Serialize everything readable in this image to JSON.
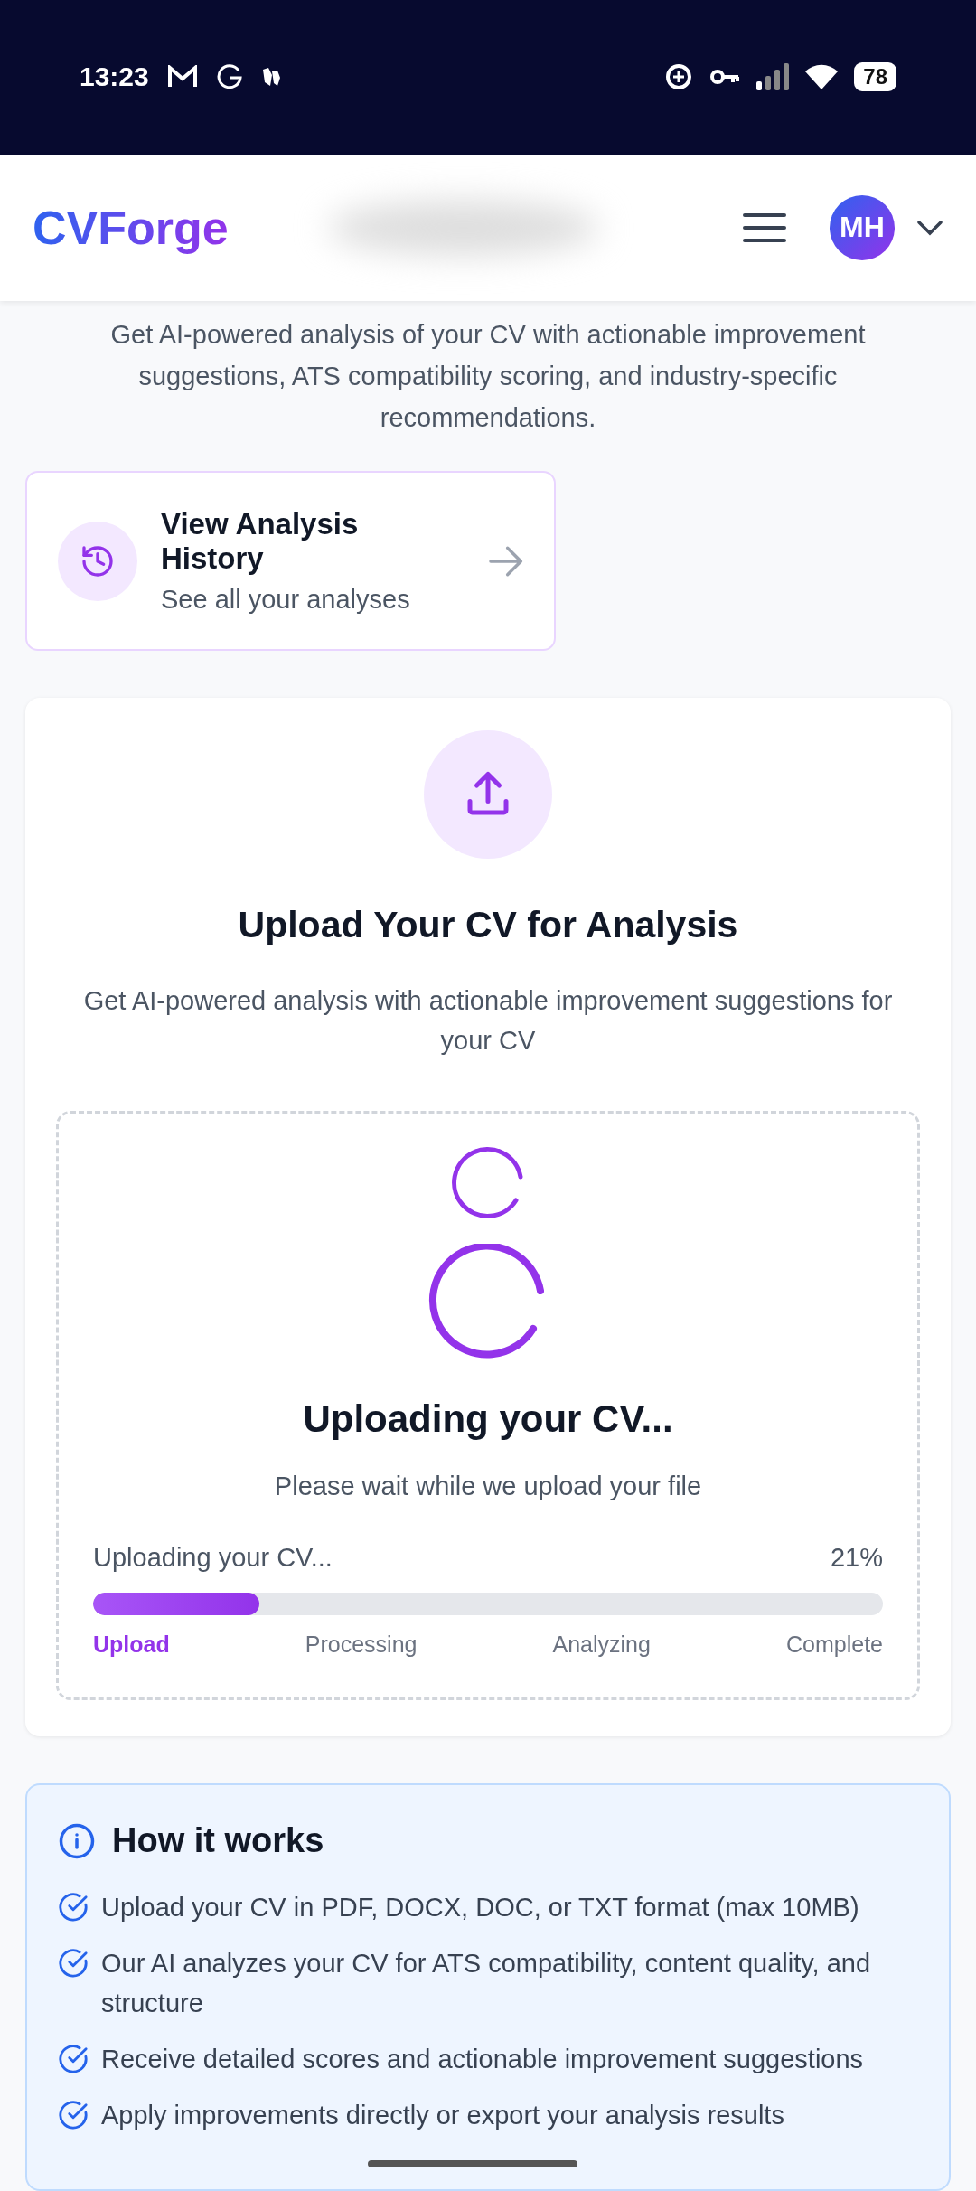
{
  "status_bar": {
    "time": "13:23",
    "battery": "78"
  },
  "header": {
    "logo": "CVForge",
    "avatar_initials": "MH"
  },
  "intro": "Get AI-powered analysis of your CV with actionable improvement suggestions, ATS compatibility scoring, and industry-specific recommendations.",
  "history_card": {
    "title": "View Analysis History",
    "subtitle": "See all your analyses"
  },
  "upload_card": {
    "title": "Upload Your CV for Analysis",
    "description": "Get AI-powered analysis with actionable improvement suggestions for your CV",
    "status_title": "Uploading your CV...",
    "status_text": "Please wait while we upload your file",
    "progress": {
      "label": "Uploading your CV...",
      "percent": "21%",
      "level": 0.21
    },
    "steps": [
      {
        "label": "Upload",
        "selected": true
      },
      {
        "label": "Processing",
        "selected": false
      },
      {
        "label": "Analyzing",
        "selected": false
      },
      {
        "label": "Complete",
        "selected": false
      }
    ]
  },
  "how_it_works": {
    "title": "How it works",
    "items": [
      "Upload your CV in PDF, DOCX, DOC, or TXT format (max 10MB)",
      "Our AI analyzes your CV for ATS compatibility, content quality, and structure",
      "Receive detailed scores and actionable improvement suggestions",
      "Apply improvements directly or export your analysis results"
    ]
  }
}
